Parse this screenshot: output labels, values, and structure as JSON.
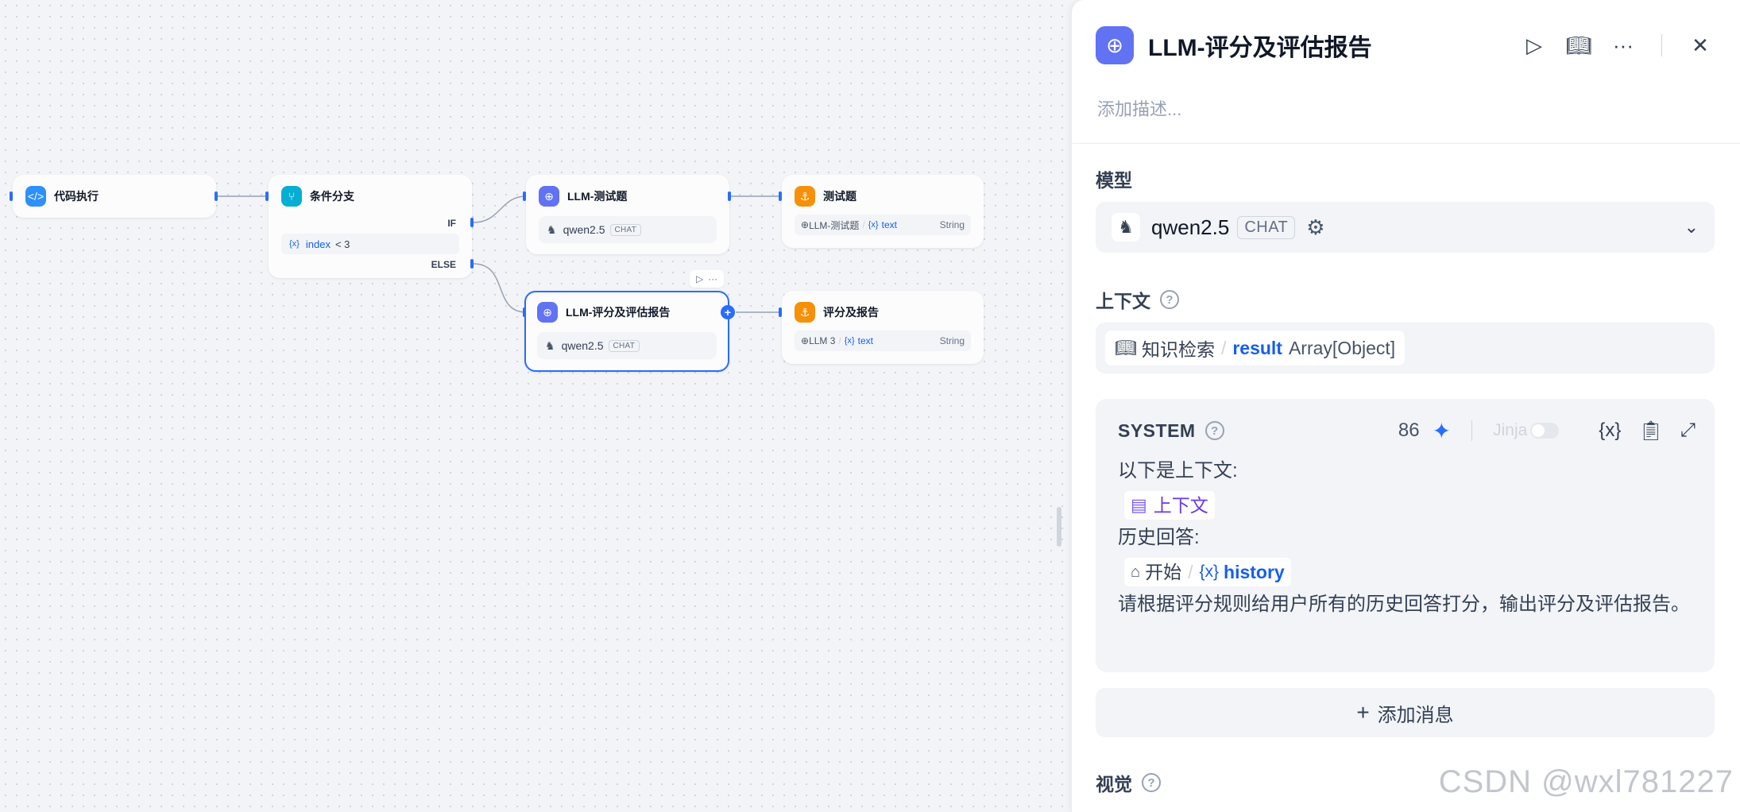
{
  "canvas": {
    "nodes": {
      "code": {
        "title": "代码执行",
        "icon": "code-icon"
      },
      "ifelse": {
        "title": "条件分支",
        "icon": "branch-icon",
        "if_label": "IF",
        "else_label": "ELSE",
        "cond_var": "index",
        "cond_op": "<",
        "cond_val": "3"
      },
      "llm_test": {
        "title": "LLM-测试题",
        "model": "qwen2.5",
        "tag": "CHAT"
      },
      "out_test": {
        "title": "测试题",
        "var_src": "LLM-测试题",
        "var_name": "text",
        "var_type": "String"
      },
      "llm_eval": {
        "title": "LLM-评分及评估报告",
        "model": "qwen2.5",
        "tag": "CHAT"
      },
      "out_eval": {
        "title": "评分及报告",
        "var_src": "LLM 3",
        "var_name": "text",
        "var_type": "String"
      }
    },
    "toolbar": {
      "run": "▷",
      "more": "···"
    }
  },
  "panel": {
    "title": "LLM-评分及评估报告",
    "description_placeholder": "添加描述...",
    "model_section": "模型",
    "model": {
      "name": "qwen2.5",
      "tag": "CHAT"
    },
    "context_section": "上下文",
    "context": {
      "source": "知识检索",
      "var": "result",
      "type": "Array[Object]"
    },
    "system": {
      "title": "SYSTEM",
      "count": "86",
      "jinja": "Jinja",
      "line1": "以下是上下文:",
      "context_var": "上下文",
      "line2": "历史回答:",
      "history_src": "开始",
      "history_var": "history",
      "line3": "请根据评分规则给用户所有的历史回答打分，输出评分及评估报告。"
    },
    "add_message": "添加消息",
    "vision_section": "视觉"
  },
  "watermark": "CSDN @wxl781227"
}
